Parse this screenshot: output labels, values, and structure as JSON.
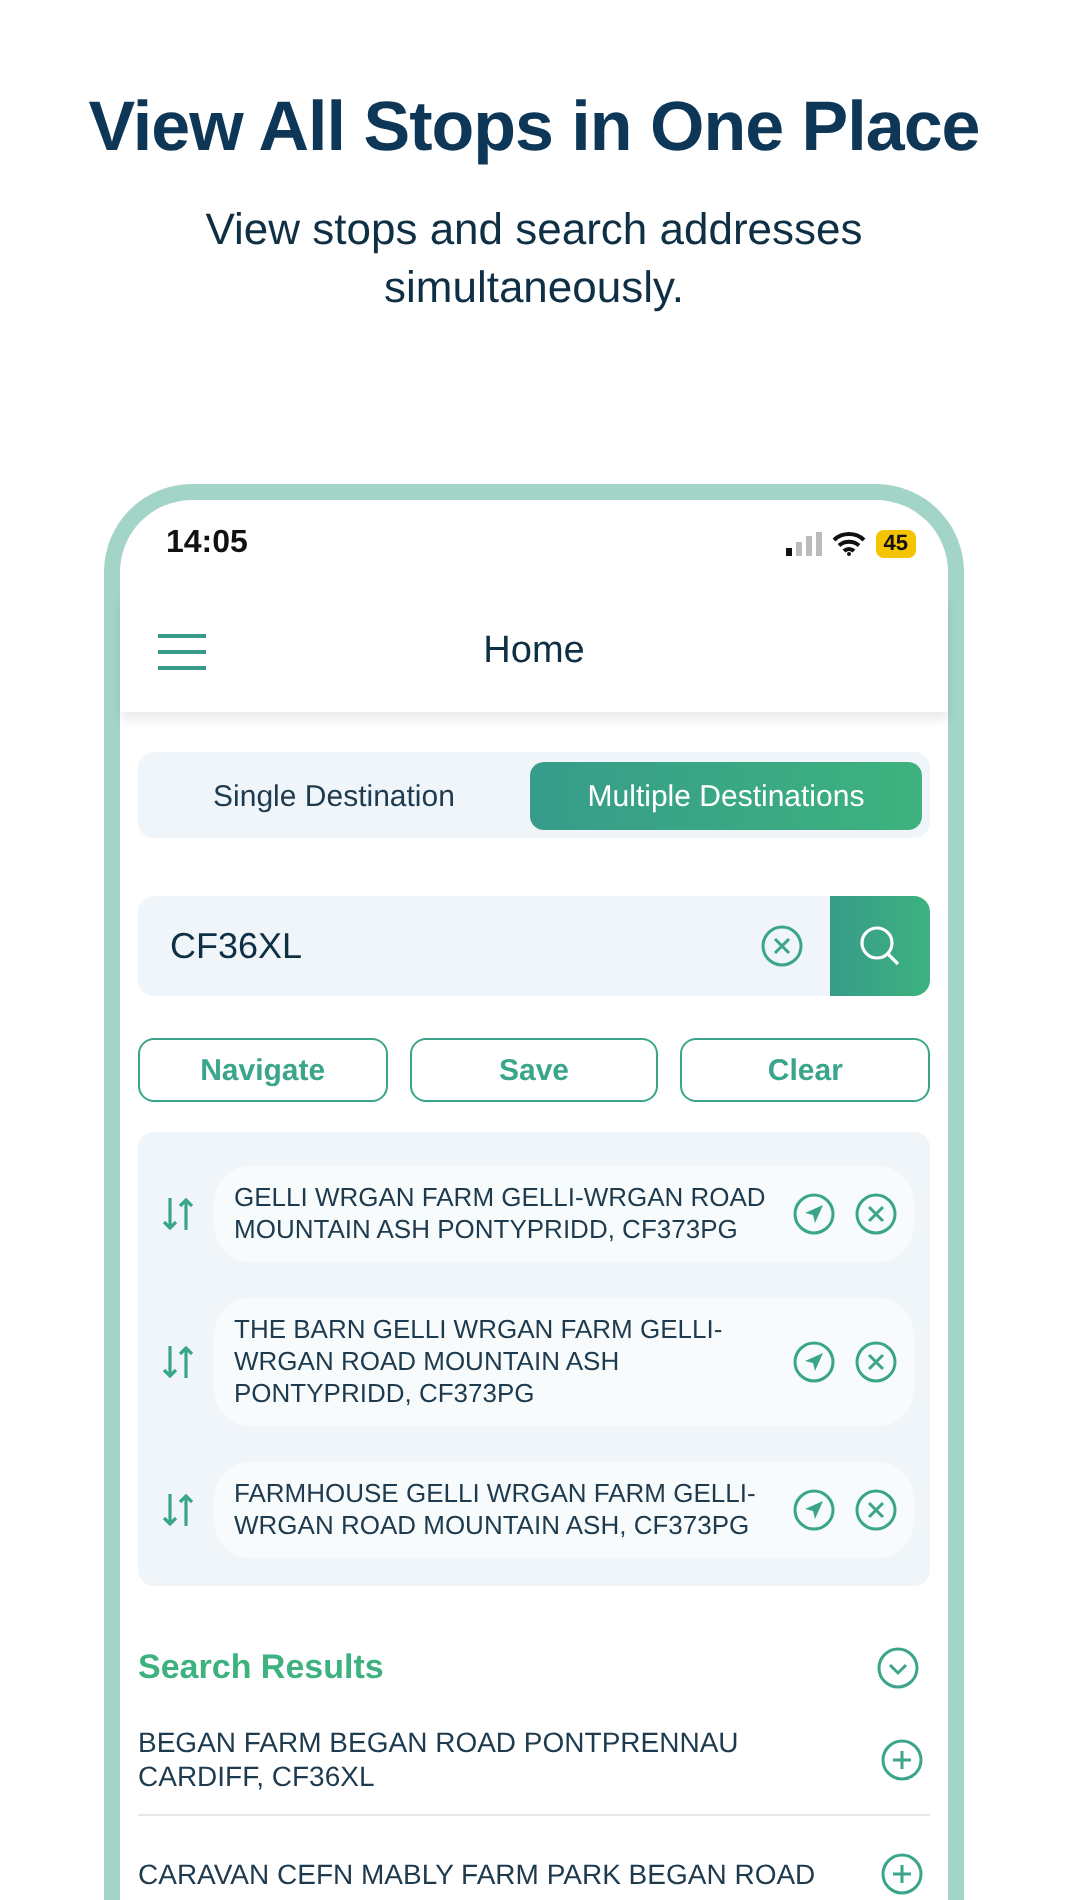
{
  "headline": "View All Stops in One Place",
  "subtitle": "View stops and search addresses simultaneously.",
  "status_bar": {
    "time": "14:05",
    "battery": "45"
  },
  "header": {
    "title": "Home"
  },
  "tabs": [
    {
      "label": "Single Destination",
      "selected": false
    },
    {
      "label": "Multiple Destinations",
      "selected": true
    }
  ],
  "search": {
    "value": "CF36XL"
  },
  "buttons": [
    "Navigate",
    "Save",
    "Clear"
  ],
  "stops": [
    {
      "address": "GELLI WRGAN FARM GELLI-WRGAN ROAD MOUNTAIN ASH PONTYPRIDD, CF373PG"
    },
    {
      "address": "THE BARN GELLI WRGAN FARM GELLI-WRGAN ROAD MOUNTAIN ASH PONTYPRIDD, CF373PG"
    },
    {
      "address": "FARMHOUSE GELLI WRGAN FARM GELLI-WRGAN ROAD MOUNTAIN ASH, CF373PG"
    }
  ],
  "search_results": {
    "title": "Search Results",
    "expanded": true,
    "items": [
      {
        "address": "BEGAN FARM BEGAN ROAD PONTPRENNAU CARDIFF, CF36XL"
      },
      {
        "address": "CARAVAN CEFN MABLY FARM PARK BEGAN ROAD"
      }
    ]
  }
}
